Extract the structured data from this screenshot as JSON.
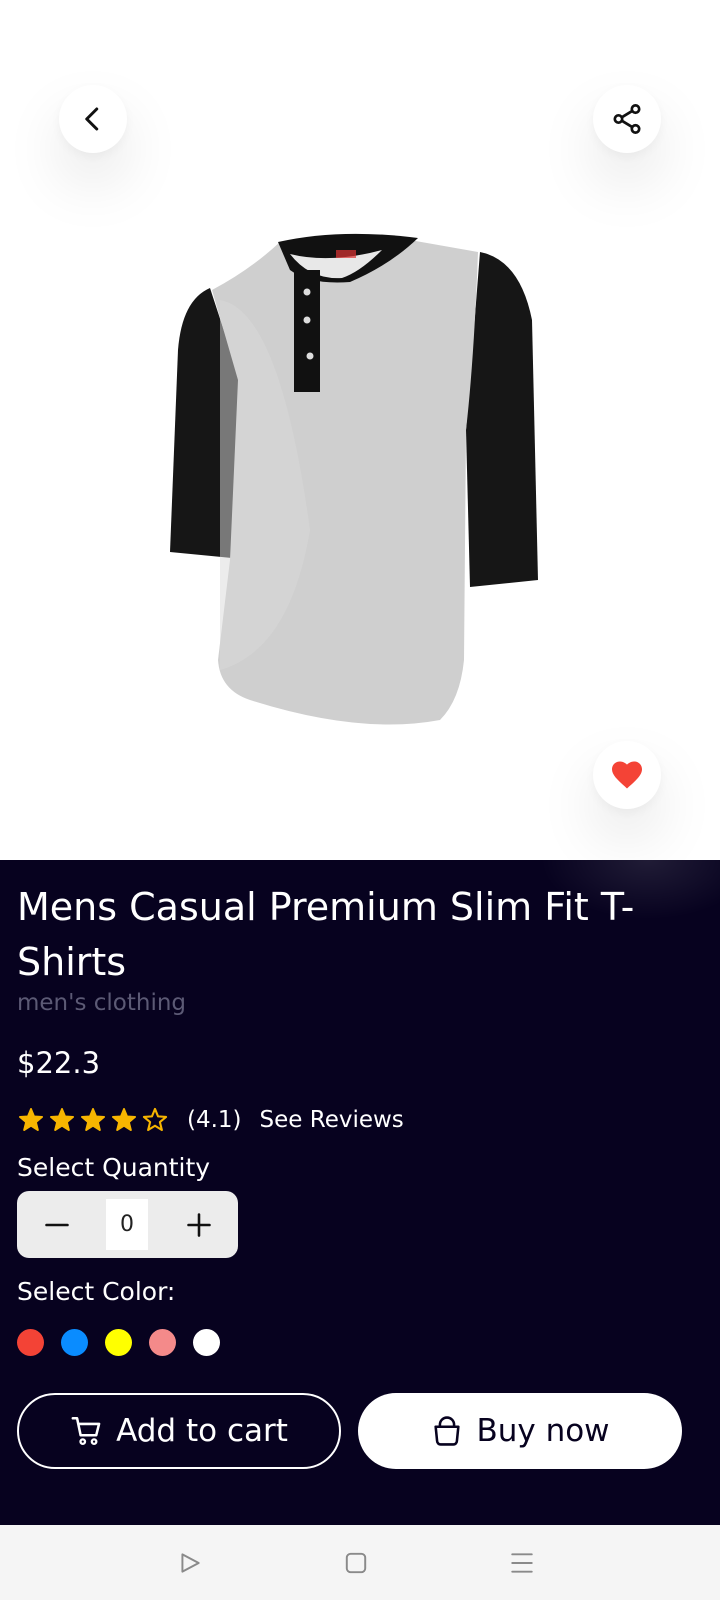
{
  "product": {
    "title": "Mens Casual Premium Slim Fit T-Shirts",
    "category": "men's clothing",
    "price": "$22.3",
    "rating": 4.1,
    "rating_label": "(4.1)",
    "see_reviews_label": "See Reviews"
  },
  "quantity": {
    "label": "Select Quantity",
    "value": "0"
  },
  "color_select": {
    "label": "Select Color:",
    "options": [
      "#f34336",
      "#0a8cff",
      "#ffff00",
      "#f48a8a",
      "#ffffff"
    ]
  },
  "actions": {
    "add_to_cart_label": "Add to cart",
    "buy_now_label": "Buy now"
  },
  "colors": {
    "accent_dark": "#07021f",
    "star": "#f7b500",
    "favorite": "#f44336"
  },
  "icons": {
    "back": "chevron-left-icon",
    "share": "share-icon",
    "favorite": "heart-icon",
    "cart": "cart-icon",
    "bag": "bag-icon"
  }
}
